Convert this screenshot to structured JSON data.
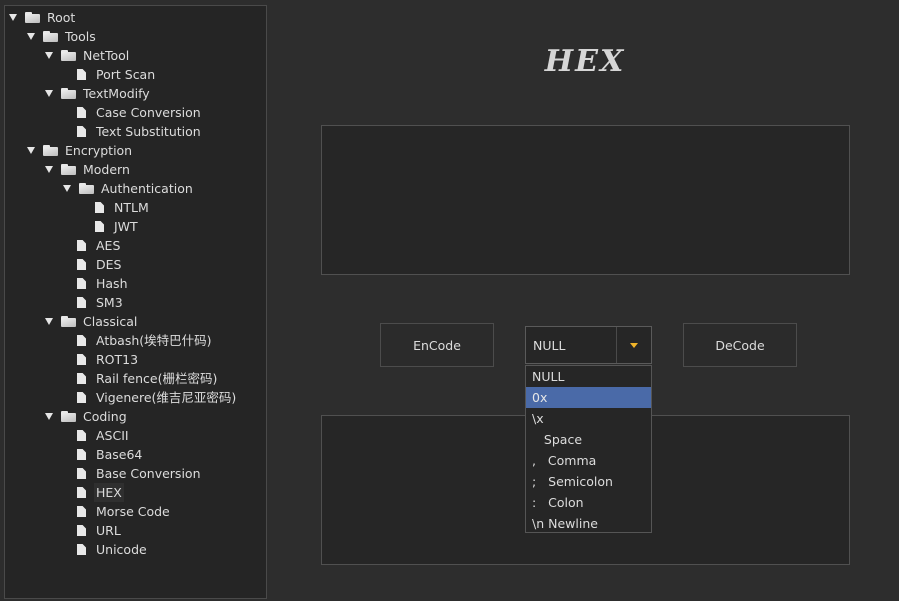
{
  "tree": [
    {
      "label": "Root",
      "depth": 0,
      "type": "folder"
    },
    {
      "label": "Tools",
      "depth": 1,
      "type": "folder"
    },
    {
      "label": "NetTool",
      "depth": 2,
      "type": "folder"
    },
    {
      "label": "Port Scan",
      "depth": 3,
      "type": "file"
    },
    {
      "label": "TextModify",
      "depth": 2,
      "type": "folder"
    },
    {
      "label": "Case Conversion",
      "depth": 3,
      "type": "file"
    },
    {
      "label": "Text Substitution",
      "depth": 3,
      "type": "file"
    },
    {
      "label": "Encryption",
      "depth": 1,
      "type": "folder"
    },
    {
      "label": "Modern",
      "depth": 2,
      "type": "folder"
    },
    {
      "label": "Authentication",
      "depth": 3,
      "type": "folder"
    },
    {
      "label": "NTLM",
      "depth": 4,
      "type": "file"
    },
    {
      "label": "JWT",
      "depth": 4,
      "type": "file"
    },
    {
      "label": "AES",
      "depth": 3,
      "type": "file"
    },
    {
      "label": "DES",
      "depth": 3,
      "type": "file"
    },
    {
      "label": "Hash",
      "depth": 3,
      "type": "file"
    },
    {
      "label": "SM3",
      "depth": 3,
      "type": "file"
    },
    {
      "label": "Classical",
      "depth": 2,
      "type": "folder"
    },
    {
      "label": "Atbash(埃特巴什码)",
      "depth": 3,
      "type": "file"
    },
    {
      "label": "ROT13",
      "depth": 3,
      "type": "file"
    },
    {
      "label": "Rail fence(栅栏密码)",
      "depth": 3,
      "type": "file"
    },
    {
      "label": "Vigenere(维吉尼亚密码)",
      "depth": 3,
      "type": "file"
    },
    {
      "label": "Coding",
      "depth": 2,
      "type": "folder"
    },
    {
      "label": "ASCII",
      "depth": 3,
      "type": "file"
    },
    {
      "label": "Base64",
      "depth": 3,
      "type": "file"
    },
    {
      "label": "Base Conversion",
      "depth": 3,
      "type": "file"
    },
    {
      "label": "HEX",
      "depth": 3,
      "type": "file",
      "selected": true
    },
    {
      "label": "Morse Code",
      "depth": 3,
      "type": "file"
    },
    {
      "label": "URL",
      "depth": 3,
      "type": "file"
    },
    {
      "label": "Unicode",
      "depth": 3,
      "type": "file"
    }
  ],
  "main": {
    "title": "HEX",
    "input_text": "",
    "output_text": "",
    "encode_label": "EnCode",
    "decode_label": "DeCode",
    "separator": {
      "selected": "NULL",
      "options": [
        "NULL",
        "0x",
        "\\x",
        "   Space",
        ",   Comma",
        ";   Semicolon",
        ":   Colon",
        "\\n Newline"
      ],
      "highlighted_index": 1
    }
  },
  "colors": {
    "background": "#2d2d2d",
    "highlight": "#4a6aa8",
    "combo_arrow": "#f0b429"
  }
}
